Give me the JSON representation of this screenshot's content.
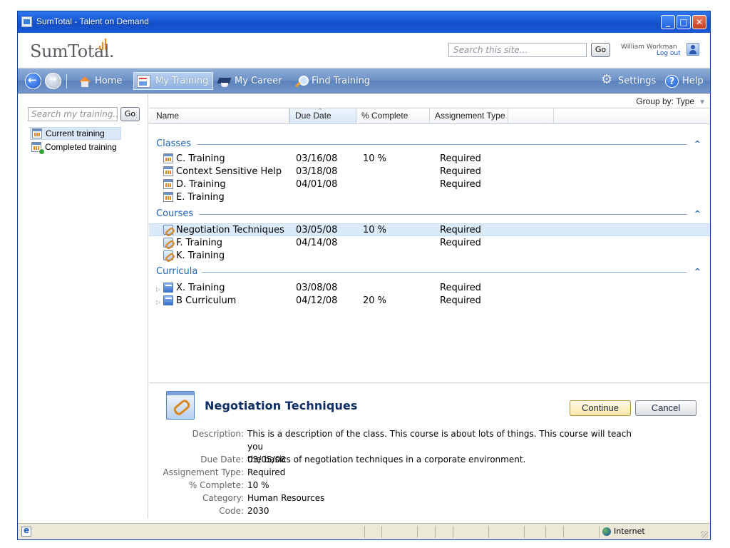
{
  "window": {
    "title": "SumTotal - Talent on Demand"
  },
  "header": {
    "logo": "SumTotal.",
    "search_placeholder": "Search this site...",
    "go_label": "Go",
    "user_name": "William Workman",
    "logout_label": "Log out"
  },
  "nav": {
    "home": "Home",
    "my_training": "My Training",
    "my_career": "My Career",
    "find_training": "Find Training",
    "settings": "Settings",
    "help": "Help"
  },
  "left_panel": {
    "search_placeholder": "Search my training...",
    "go_label": "Go",
    "items": [
      {
        "label": "Current training"
      },
      {
        "label": "Completed training"
      }
    ]
  },
  "main": {
    "group_by_label": "Group by: Type",
    "columns": [
      "Name",
      "Due Date",
      "% Complete",
      "Assignement Type"
    ],
    "groups": [
      {
        "title": "Classes",
        "rows": [
          {
            "name": "C. Training",
            "due": "03/16/08",
            "pct": "10 %",
            "type": "Required"
          },
          {
            "name": "Context Sensitive Help",
            "due": "03/18/08",
            "pct": "",
            "type": "Required"
          },
          {
            "name": "D. Training",
            "due": "04/01/08",
            "pct": "",
            "type": "Required"
          },
          {
            "name": "E. Training",
            "due": "",
            "pct": "",
            "type": ""
          }
        ]
      },
      {
        "title": "Courses",
        "rows": [
          {
            "name": "Negotiation Techniques",
            "due": "03/05/08",
            "pct": "10 %",
            "type": "Required"
          },
          {
            "name": "F. Training",
            "due": "04/14/08",
            "pct": "",
            "type": "Required"
          },
          {
            "name": "K. Training",
            "due": "",
            "pct": "",
            "type": ""
          }
        ]
      },
      {
        "title": "Curricula",
        "rows": [
          {
            "name": "X. Training",
            "due": "03/08/08",
            "pct": "",
            "type": "Required"
          },
          {
            "name": "B Curriculum",
            "due": "04/12/08",
            "pct": "20 %",
            "type": "Required"
          }
        ]
      }
    ]
  },
  "details": {
    "title": "Negotiation Techniques",
    "continue_label": "Continue",
    "cancel_label": "Cancel",
    "description_label": "Description:",
    "description_line1": "This is a description of the class. This course is about lots of things. This course will teach you",
    "description_line2": "the basics of negotiation techniques in a corporate environment.",
    "fields": [
      {
        "label": "Due Date:",
        "value": "03/05/08"
      },
      {
        "label": "Assignement Type:",
        "value": "Required"
      },
      {
        "label": "% Complete:",
        "value": "10 %"
      },
      {
        "label": "Category:",
        "value": "Human Resources"
      },
      {
        "label": "Code:",
        "value": "2030"
      }
    ]
  },
  "status_bar": {
    "zone": "Internet"
  }
}
